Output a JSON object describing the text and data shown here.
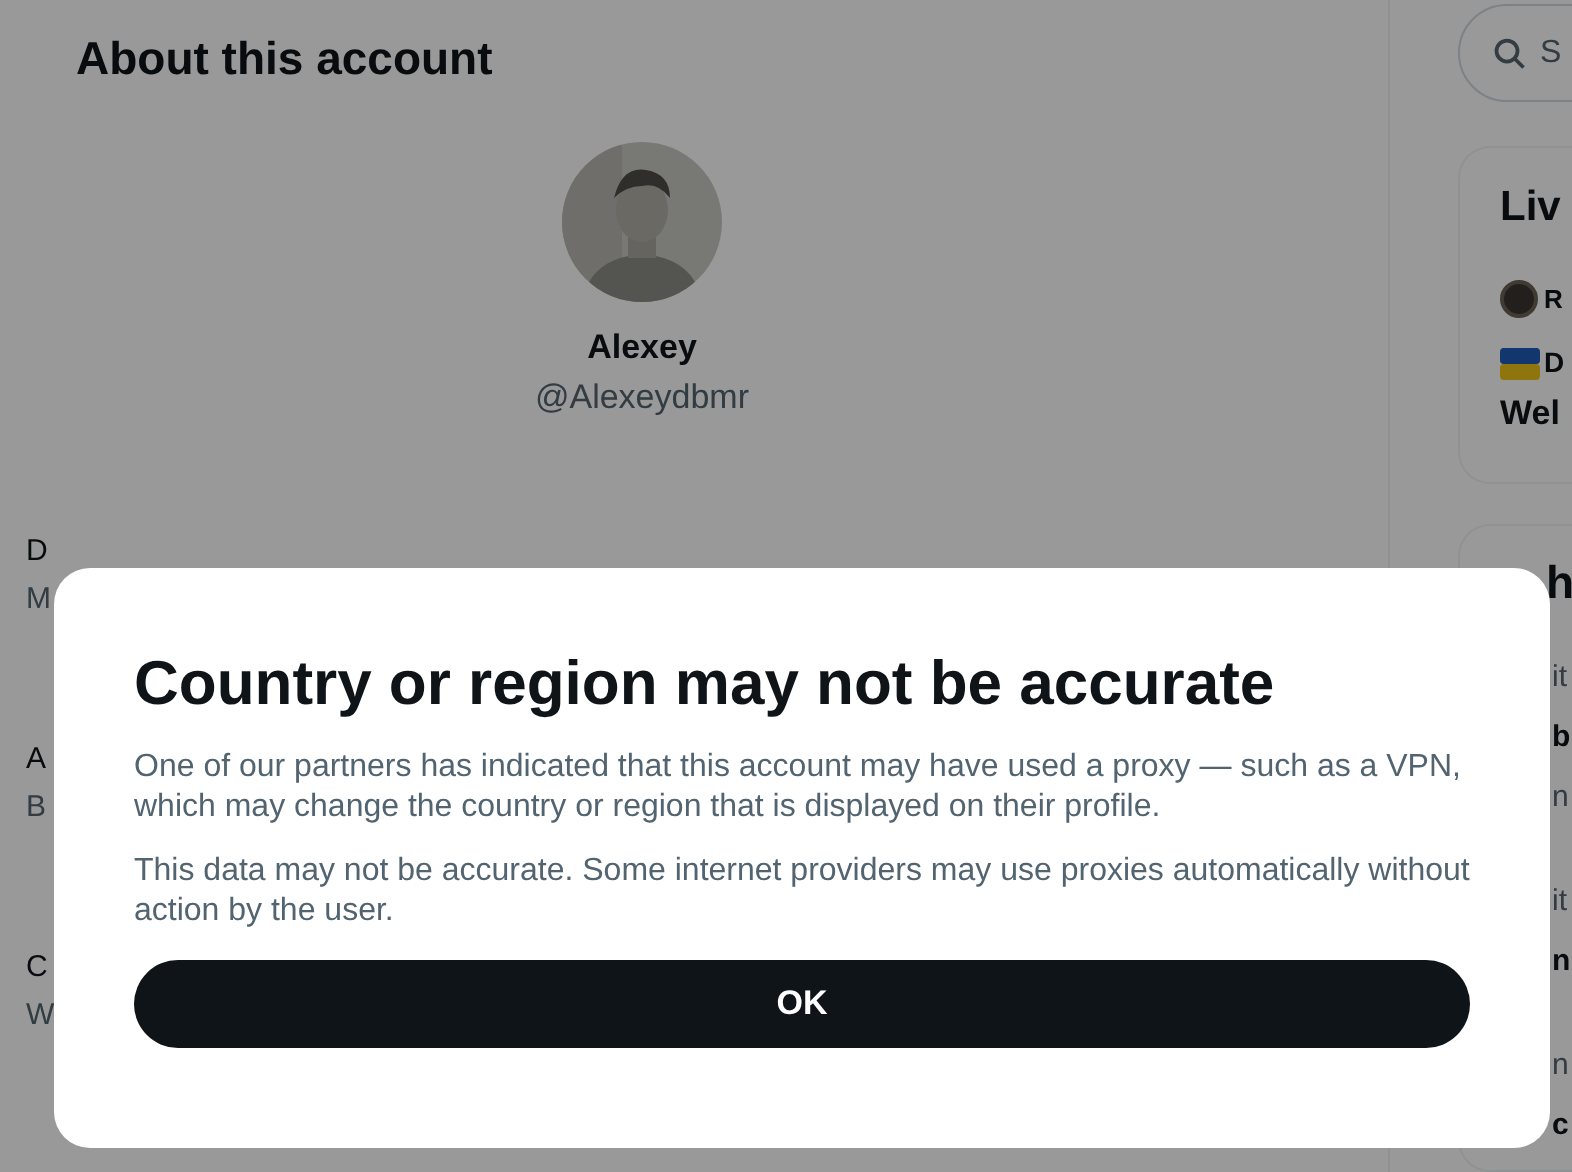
{
  "page": {
    "title": "About this account",
    "profile": {
      "name": "Alexey",
      "handle": "@Alexeydbmr"
    },
    "details": [
      {
        "label": "D",
        "value": "M"
      },
      {
        "label": "A",
        "value": "B"
      },
      {
        "label": "C",
        "value": "W"
      }
    ]
  },
  "sidebar": {
    "search": {
      "placeholder": "S"
    },
    "live": {
      "title": "Liv",
      "host": "R",
      "lines": [
        "D",
        "Wel"
      ]
    },
    "trends": {
      "title": "h",
      "items": [
        {
          "kind": "meta",
          "text": "it"
        },
        {
          "kind": "title",
          "text": "b"
        },
        {
          "kind": "meta",
          "text": "n"
        },
        {
          "kind": "meta",
          "text": "it"
        },
        {
          "kind": "title",
          "text": "n"
        },
        {
          "kind": "meta",
          "text": "n"
        },
        {
          "kind": "title",
          "text": "c"
        }
      ]
    }
  },
  "dialog": {
    "title": "Country or region may not be accurate",
    "paragraphs": [
      "One of our partners has indicated that this account may have used a proxy — such as a VPN, which may change the country or region that is displayed on their profile.",
      "This data may not be accurate. Some internet providers may use proxies automatically without action by the user."
    ],
    "button": "OK"
  }
}
